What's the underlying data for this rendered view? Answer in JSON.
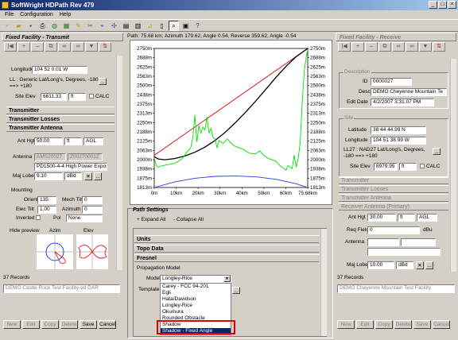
{
  "window": {
    "title": "SoftWright HDPath Rev 479"
  },
  "menu": [
    "File",
    "Configuration",
    "Help"
  ],
  "toolbar_icons": [
    "new-icon",
    "open-icon",
    "save-icon",
    "print-icon",
    "globe-icon",
    "map-icon",
    "pencil-icon",
    "tools-icon",
    "antenna-icon",
    "compass-icon",
    "grid-icon",
    "table-icon",
    "profile-icon",
    "document-icon",
    "search-icon",
    "settings-icon",
    "help-icon"
  ],
  "path_info": "Path: 75.68 km; Azimuth 179.62, Angle 0.54, Reverse 359.62, Angle -0.54",
  "left": {
    "header": "Fixed Facility - Transmit",
    "longitude": "104 52 0.01 W",
    "ll_label": "LL : Generic Lat/Long's, Degrees, -180 ==> +180",
    "site_elev_label": "Site Elev",
    "site_elev": "6611.33",
    "site_elev_unit": "ft",
    "calc": "CALC",
    "sections": [
      "Transmitter",
      "Transmitter Losses",
      "Transmitter Antenna"
    ],
    "ant_hgt_label": "Ant Hgt",
    "ant_hgt": "50.00",
    "ant_hgt_unit": "ft",
    "ant_hgt_ref": "AGL",
    "antenna_label": "Antenna",
    "antenna_code1": "AMS20027",
    "antenna_code2": "Z00270001Z",
    "antenna_desc": "PD1500-4-4 High Power Expos",
    "maj_lobe_label": "Maj Lobe",
    "maj_lobe": "9.10",
    "maj_lobe_unit": "dBd",
    "mounting_label": "Mounting",
    "orient_label": "Orient",
    "orient": "135",
    "mech_tilt_label": "Mech Tilt",
    "mech_tilt": "0",
    "elec_tilt_label": "Elec Tilt",
    "elec_tilt": "1.00",
    "azimuth_label": "Azimuth",
    "azimuth": "0",
    "inverted_label": "Inverted",
    "pol_label": "Pol",
    "pol": "None",
    "hide_preview": "Hide preview",
    "azim_label": "Azim",
    "elev_label": "Elev",
    "records": "37 Records",
    "record_select": "DEMO Castle Rock Test Facility-ed DAR",
    "buttons": [
      "New",
      "Edit",
      "Copy",
      "Delete",
      "Save",
      "Cancel"
    ]
  },
  "right": {
    "header": "Fixed Facility - Receive",
    "description_title": "Description",
    "id_label": "ID",
    "id": "0000027",
    "desc_label": "Desc",
    "desc": "DEMO Cheyenne Mountain Te",
    "edit_date_label": "Edit Date",
    "edit_date": "4/2/2007 3:31:07 PM",
    "site_title": "Site",
    "latitude_label": "Latitude",
    "latitude": "38 44 44.99 N",
    "longitude_label": "Longitude",
    "longitude": "104 51 38.99 W",
    "ll_label": "LL27 : NAD27 Lat/Long's, Degrees, -180 ==> +180",
    "site_elev_label": "Site Elev",
    "site_elev": "8979.95",
    "site_elev_unit": "ft",
    "calc": "CALC",
    "sections": [
      "Transmitter",
      "Transmitter Losses",
      "Transmitter Antenna",
      "Receiver Antenna (Primary)"
    ],
    "ant_hgt_label": "Ant Hgt",
    "ant_hgt": "30.00",
    "ant_hgt_unit": "ft",
    "ant_hgt_ref": "AGL",
    "req_field_label": "Req Field",
    "req_field": "0",
    "req_field_unit": "dBu",
    "antenna_label": "Antenna",
    "maj_lobe_label": "Maj Lobe",
    "maj_lobe": "10.00",
    "maj_lobe_unit": "dBd",
    "records": "37 Records",
    "record_select": "DEMO Cheyenne Mountain Test Facility",
    "buttons": [
      "New",
      "Edit",
      "Copy",
      "Delete",
      "Save",
      "Cancel"
    ]
  },
  "path_settings": {
    "title": "Path Settings",
    "expand_all": "+ Expand All",
    "collapse_all": "- Collapse All",
    "sections": [
      "Units",
      "Topo Data",
      "Fresnel"
    ],
    "propagation_model_label": "Propagation Model",
    "model_label": "Model",
    "model_value": "Longley-Rice",
    "template_label": "Template",
    "dropdown_options": [
      "Carey - FCC 94-201",
      "Egli",
      "Hata/Davidson",
      "Longley-Rice",
      "Okumura",
      "Rounded Obstacle",
      "Shadow",
      "Shadow - Fixed Angle"
    ],
    "selected_option": "Shadow - Fixed Angle"
  },
  "colors": {
    "terrain": "#00e000",
    "los": "#e00000",
    "fresnel": "#000000",
    "earth": "#2040e0",
    "highlight": "#e00000"
  },
  "chart_data": {
    "type": "line",
    "x_ticks": [
      "0m",
      "10km",
      "20km",
      "30km",
      "40km",
      "50km",
      "60km",
      "75.68km"
    ],
    "y_ticks_left": [
      "2750m",
      "2688m",
      "2625m",
      "2563m",
      "2500m",
      "2438m",
      "2375m",
      "2313m",
      "2250m",
      "2188m",
      "2125m",
      "2063m",
      "2000m",
      "1938m",
      "1875m",
      "1813m"
    ],
    "y_ticks_right": [
      "2750m",
      "2688m",
      "2625m",
      "2563m",
      "2500m",
      "2438m",
      "2375m",
      "2313m",
      "2250m",
      "2188m",
      "2125m",
      "2063m",
      "2000m",
      "1938m",
      "1875m",
      "1813m"
    ],
    "xlim": [
      0,
      75.68
    ],
    "ylim": [
      1813,
      2750
    ],
    "series": [
      {
        "color": "#e00000",
        "x": [
          0,
          75.68
        ],
        "y": [
          2030,
          2750
        ]
      },
      {
        "color": "#000000",
        "x": [
          0,
          2,
          5,
          10,
          15,
          20,
          25,
          30,
          35,
          40,
          45,
          50,
          55,
          60,
          65,
          70,
          75.68
        ],
        "y": [
          2020,
          2005,
          2000,
          2008,
          2025,
          2050,
          2085,
          2130,
          2185,
          2250,
          2320,
          2395,
          2475,
          2555,
          2630,
          2695,
          2750
        ]
      },
      {
        "color": "#2040e0",
        "x": [
          0,
          10,
          20,
          30,
          40,
          50,
          60,
          70,
          75.68
        ],
        "y": [
          1813,
          1850,
          1875,
          1888,
          1890,
          1885,
          1868,
          1838,
          1813
        ]
      },
      {
        "color": "#00e000",
        "x": [
          0,
          1,
          2,
          4,
          6,
          8,
          10,
          12,
          14,
          16,
          18,
          19,
          20,
          21,
          22,
          23,
          24,
          25,
          26,
          27,
          28,
          29,
          30,
          31,
          32,
          34,
          36,
          38,
          40,
          42,
          44,
          46,
          48,
          50,
          52,
          54,
          56,
          58,
          60,
          62,
          64,
          65,
          66,
          67,
          68,
          69,
          70,
          71,
          72,
          73,
          74,
          75,
          75.68
        ],
        "y": [
          2010,
          1960,
          1950,
          1960,
          1965,
          1970,
          1975,
          1990,
          2010,
          2050,
          2080,
          2150,
          2300,
          2120,
          2230,
          2180,
          2220,
          2200,
          2290,
          2180,
          2210,
          2150,
          2140,
          2080,
          2130,
          2110,
          2140,
          2110,
          2090,
          2080,
          2070,
          2050,
          2040,
          2040,
          2060,
          2030,
          2010,
          2000,
          1990,
          1960,
          1940,
          1930,
          1960,
          1950,
          1940,
          2030,
          1950,
          2010,
          2120,
          2400,
          2600,
          2700,
          2740
        ]
      }
    ]
  }
}
